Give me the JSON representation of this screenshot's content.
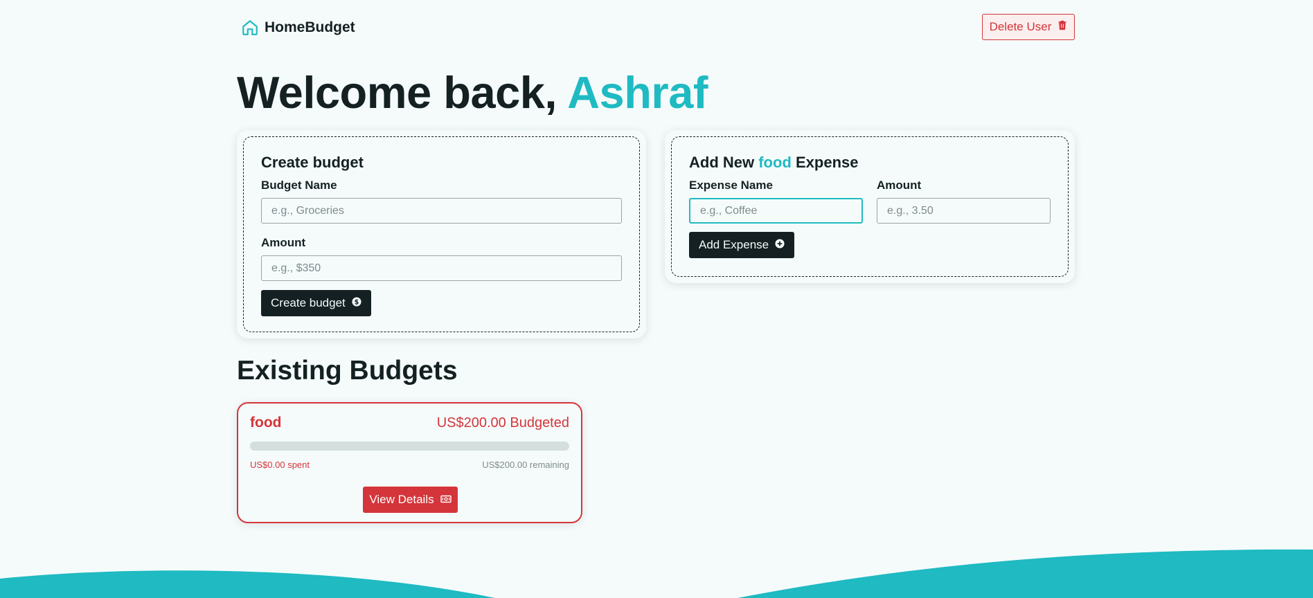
{
  "nav": {
    "brand": "HomeBudget",
    "brand_icon": "home-icon",
    "delete_label": "Delete User",
    "delete_icon": "trash-icon"
  },
  "welcome": {
    "prefix": "Welcome back, ",
    "name": "Ashraf"
  },
  "create_budget": {
    "title": "Create budget",
    "name_label": "Budget Name",
    "name_placeholder": "e.g., Groceries",
    "amount_label": "Amount",
    "amount_placeholder": "e.g., $350",
    "submit_label": "Create budget",
    "submit_icon": "dollar-circle-icon"
  },
  "add_expense": {
    "title_prefix": "Add New ",
    "title_budget": "food",
    "title_suffix": " Expense",
    "name_label": "Expense Name",
    "name_placeholder": "e.g., Coffee",
    "amount_label": "Amount",
    "amount_placeholder": "e.g., 3.50",
    "submit_label": "Add Expense",
    "submit_icon": "plus-circle-icon"
  },
  "existing": {
    "title": "Existing Budgets",
    "budgets": [
      {
        "name": "food",
        "budgeted": "US$200.00 Budgeted",
        "spent": "US$0.00 spent",
        "remaining": "US$200.00 remaining",
        "progress_fraction": 0,
        "view_label": "View Details",
        "view_icon": "banknote-icon"
      }
    ]
  },
  "colors": {
    "accent": "#1fbac2",
    "dark": "#142022",
    "danger": "#d4353a",
    "background": "#f5fbfb"
  }
}
